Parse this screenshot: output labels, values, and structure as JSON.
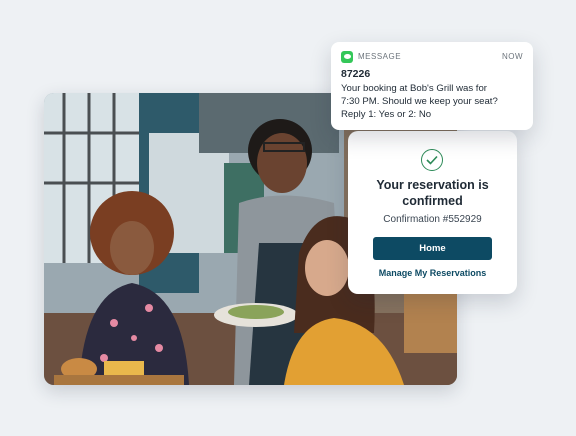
{
  "notification": {
    "app_name": "MESSAGE",
    "time": "NOW",
    "sender": "87226",
    "lines": [
      "Your booking at Bob's Grill was for",
      "7:30 PM. Should we keep your seat?",
      "Reply 1: Yes or 2: No"
    ],
    "icon": "messages-app-icon"
  },
  "reservation_card": {
    "title_lines": [
      "Your reservation is",
      "confirmed"
    ],
    "confirmation": "Confirmation #552929",
    "home_button": "Home",
    "manage_link": "Manage My Reservations",
    "icon": "check-circle-icon"
  },
  "colors": {
    "background": "#eef1f4",
    "primary": "#0d4a63",
    "success": "#2c8a57",
    "message_green": "#34c759"
  }
}
